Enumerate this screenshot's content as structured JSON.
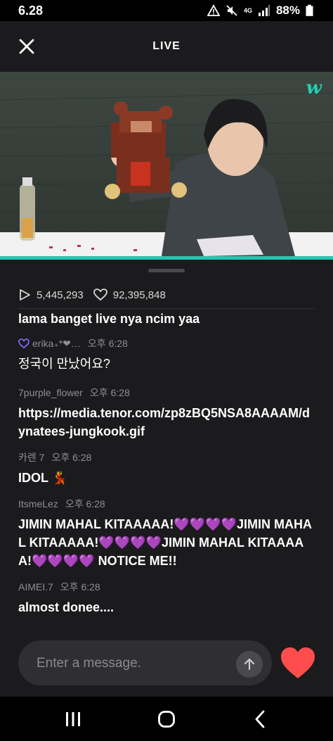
{
  "status_bar": {
    "time": "6.28",
    "network": "4G",
    "battery": "88%"
  },
  "header": {
    "title": "LIVE"
  },
  "video": {
    "progress": 1.0
  },
  "stats": {
    "views": "5,445,293",
    "likes": "92,395,848"
  },
  "messages": [
    {
      "author": "",
      "time": "",
      "text": "lama banget live nya ncim yaa"
    },
    {
      "author": "erika₊*❤…",
      "time": "오후 6:28",
      "text": "정국이 만났어요?"
    },
    {
      "author": "7purple_flower",
      "time": "오후 6:28",
      "text": "https://media.tenor.com/zp8zBQ5NSA8AAAAM/dynatees-jungkook.gif"
    },
    {
      "author": "카렌 7",
      "time": "오후 6:28",
      "text": "IDOL 💃"
    },
    {
      "author": "ItsmeLez",
      "time": "오후 6:28",
      "text": "JIMIN MAHAL KITAAAAA!💜💜💜💜JIMIN MAHAL KITAAAAA!💜💜💜💜JIMIN MAHAL KITAAAAA!💜💜💜💜 NOTICE ME!!"
    },
    {
      "author": "AIMEI.7",
      "time": "오후 6:28",
      "text": "almost donee...."
    }
  ],
  "input": {
    "placeholder": "Enter a message."
  },
  "colors": {
    "accent": "#29c4b0",
    "heart": "#ff4d4d",
    "background": "#1b1b1d"
  },
  "icons": [
    "close-icon",
    "play-icon",
    "heart-outline-icon",
    "send-arrow-icon",
    "heart-filled-icon",
    "recents-icon",
    "home-icon",
    "back-icon",
    "weverse-logo"
  ]
}
